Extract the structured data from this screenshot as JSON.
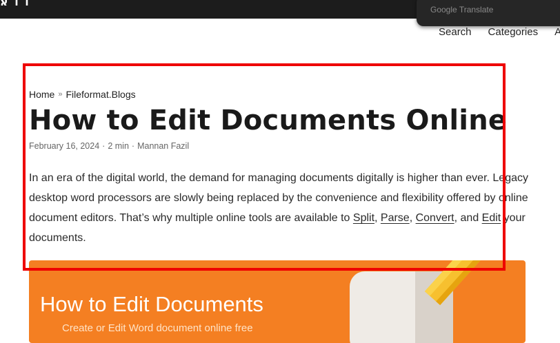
{
  "topbar": {
    "logo_fragment": "ו ו א",
    "translate_label": "Google Translate"
  },
  "nav": {
    "items": [
      "Search",
      "Categories",
      "A"
    ]
  },
  "breadcrumb": {
    "home": "Home",
    "separator": "»",
    "current": "Fileformat.Blogs"
  },
  "article": {
    "title": "How to Edit Documents Online",
    "date": "February 16, 2024",
    "read_time": "2 min",
    "author": "Mannan Fazil",
    "meta_separator": "·",
    "intro": "In an era of the digital world, the demand for managing documents digitally is higher than ever. Legacy desktop word processors are slowly being replaced by the convenience and flexibility offered by online document editors. That’s why multiple online tools are available to ",
    "links": [
      "Split",
      "Parse",
      "Convert",
      "Edit"
    ],
    "comma": ", ",
    "and_text": ", and ",
    "outro": " your documents."
  },
  "banner": {
    "title": "How to Edit Documents",
    "subtitle": "Create or Edit Word document online free",
    "color": "#f47f22"
  },
  "colors": {
    "highlight": "#ee0000",
    "topbar": "#1c1c1c"
  }
}
